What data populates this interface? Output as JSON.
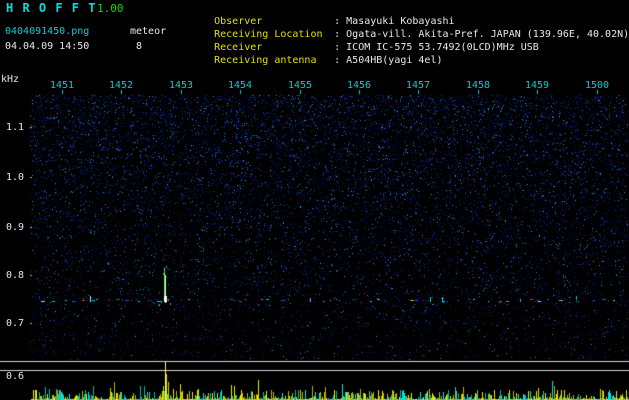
{
  "header": {
    "app_title": "H R O F F T",
    "app_version": "1.00",
    "filename": "0404091450.png",
    "mode": "meteor",
    "datetime": "04.04.09 14:50",
    "count": "8",
    "info": [
      {
        "label": "Observer",
        "value": ": Masayuki Kobayashi"
      },
      {
        "label": "Receiving Location",
        "value": ": Ogata-vill. Akita-Pref. JAPAN (139.96E, 40.02N)"
      },
      {
        "label": "Receiver",
        "value": ": ICOM IC-575 53.7492(0LCD)MHz USB"
      },
      {
        "label": "Receiving antenna",
        "value": ": A504HB(yagi 4el)"
      }
    ]
  },
  "colors": {
    "title": "#00dede",
    "version": "#00e000",
    "filename": "#00cfcf",
    "white": "#e8e8e8",
    "label": "#e0e000",
    "xtick": "#00cfcf",
    "ytick": "#d8e8e8",
    "meterline": "#d8d8d8",
    "spike_yellow": "#e8e800",
    "spike_cyan": "#00dada",
    "noise_blue": "#0020a0"
  },
  "chart_data": {
    "type": "heatmap",
    "subtype": "radio-meteor-spectrogram",
    "title": "",
    "x_axis": {
      "ticks": [
        "1451",
        "1452",
        "1453",
        "1454",
        "1455",
        "1456",
        "1457",
        "1458",
        "1459",
        "1500"
      ]
    },
    "y_axis": {
      "unit_label": "kHz",
      "ticks": [
        "1.1",
        "1.0",
        "0.9",
        "0.8",
        "0.7",
        "0.6"
      ],
      "tick_values_khz": [
        1.1,
        1.0,
        0.9,
        0.8,
        0.7,
        0.6
      ],
      "range_khz": [
        0.55,
        1.18
      ]
    },
    "carrier_line_khz": 0.75,
    "events": [
      {
        "time": "1452.8",
        "freq_khz": 0.75,
        "description": "strong meteor echo spike (green/white) on carrier line"
      }
    ],
    "bottom_meter": {
      "description": "signal-level strip of yellow/cyan spikes; strongest yellow spike at 1452.8"
    },
    "background": "dark blue speckle noise, denser toward top of spectrogram"
  }
}
